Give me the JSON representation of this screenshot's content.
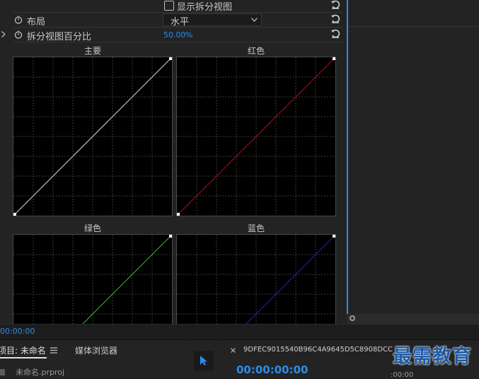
{
  "effect_controls": {
    "show_split_view_label": "显示拆分视图",
    "layout_label": "布局",
    "layout_value": "水平",
    "split_percent_label": "拆分视图百分比",
    "split_percent_value": "50.00",
    "split_percent_unit": "%"
  },
  "curves": {
    "master_title": "主要",
    "red_title": "红色",
    "green_title": "绿色",
    "blue_title": "蓝色",
    "colors": {
      "master": "#d8d8d8",
      "red": "#b01010",
      "green": "#2fbf2f",
      "blue": "#2020c8"
    }
  },
  "timecode_bar": {
    "timecode": "00:00:00"
  },
  "project_panel": {
    "tab_project": "项目: 未命名",
    "tab_media_browser": "媒体浏览器",
    "file_name": "未命名.prproj"
  },
  "program_panel": {
    "sequence_id": "9DFEC9015540B96C4A9645D5C8908DCC",
    "timecode": "00:00:00:00",
    "right_timecode": ":00:00"
  },
  "watermark": "最需教育",
  "accent_color": "#2d8ceb"
}
